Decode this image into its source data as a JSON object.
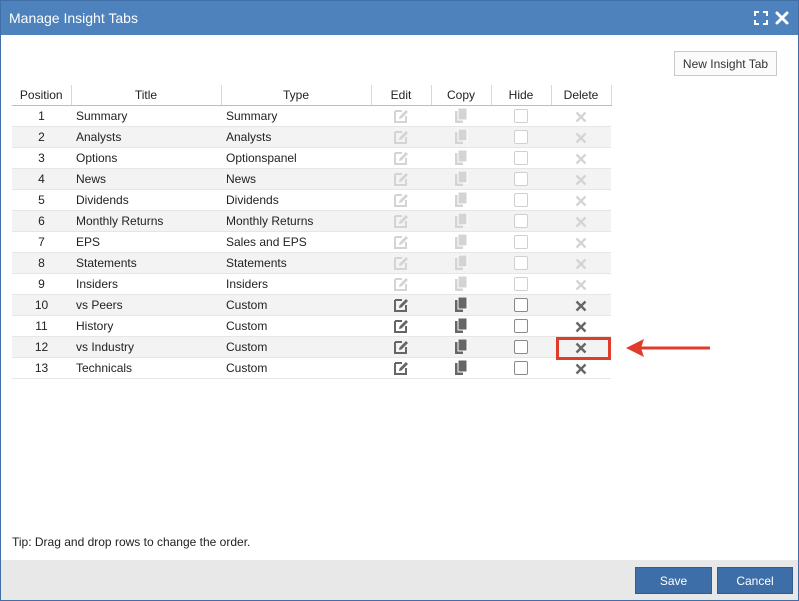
{
  "dialog": {
    "title": "Manage Insight Tabs",
    "new_tab_label": "New Insight Tab",
    "tip": "Tip: Drag and drop rows to change the order.",
    "save_label": "Save",
    "cancel_label": "Cancel"
  },
  "table": {
    "headers": {
      "position": "Position",
      "title": "Title",
      "type": "Type",
      "edit": "Edit",
      "copy": "Copy",
      "hide": "Hide",
      "delete": "Delete"
    },
    "rows": [
      {
        "position": "1",
        "title": "Summary",
        "type": "Summary",
        "enabled": false
      },
      {
        "position": "2",
        "title": "Analysts",
        "type": "Analysts",
        "enabled": false
      },
      {
        "position": "3",
        "title": "Options",
        "type": "Optionspanel",
        "enabled": false
      },
      {
        "position": "4",
        "title": "News",
        "type": "News",
        "enabled": false
      },
      {
        "position": "5",
        "title": "Dividends",
        "type": "Dividends",
        "enabled": false
      },
      {
        "position": "6",
        "title": "Monthly Returns",
        "type": "Monthly Returns",
        "enabled": false
      },
      {
        "position": "7",
        "title": "EPS",
        "type": "Sales and EPS",
        "enabled": false
      },
      {
        "position": "8",
        "title": "Statements",
        "type": "Statements",
        "enabled": false
      },
      {
        "position": "9",
        "title": "Insiders",
        "type": "Insiders",
        "enabled": false
      },
      {
        "position": "10",
        "title": "vs Peers",
        "type": "Custom",
        "enabled": true
      },
      {
        "position": "11",
        "title": "History",
        "type": "Custom",
        "enabled": true
      },
      {
        "position": "12",
        "title": "vs Industry",
        "type": "Custom",
        "enabled": true
      },
      {
        "position": "13",
        "title": "Technicals",
        "type": "Custom",
        "enabled": true
      }
    ]
  },
  "annotation": {
    "highlighted_row": "12",
    "color": "#e03c2b"
  },
  "colors": {
    "titlebar": "#4d82bc",
    "button": "#3d6ea8",
    "icon_enabled": "#666666",
    "icon_disabled": "#d4d4d4"
  }
}
